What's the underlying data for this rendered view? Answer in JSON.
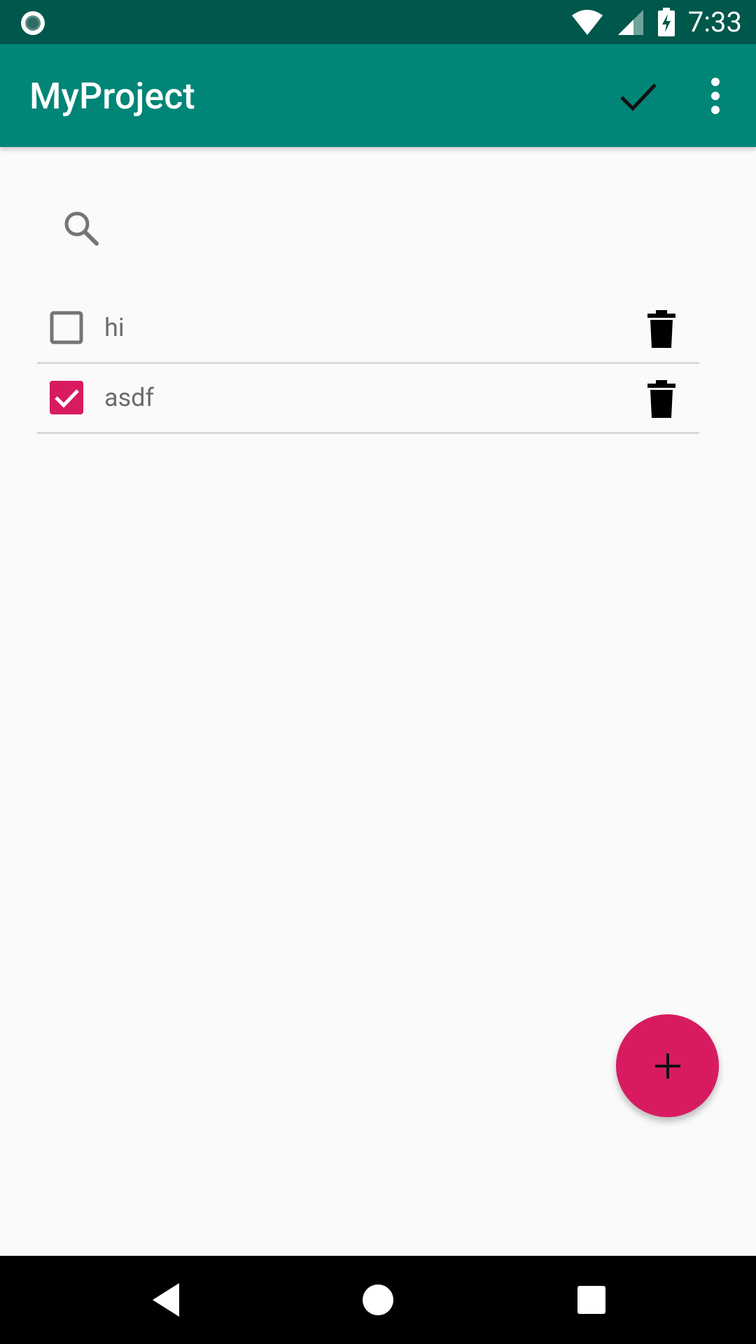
{
  "status_bar": {
    "time": "7:33",
    "icons": [
      "notification-dot-icon",
      "wifi-icon",
      "signal-icon",
      "battery-charging-icon"
    ]
  },
  "app_bar": {
    "title": "MyProject",
    "actions": [
      "check-icon",
      "more-vert-icon"
    ],
    "color": "#008577",
    "status_color": "#00574b"
  },
  "search": {
    "icon": "search-icon"
  },
  "todo_list": {
    "items": [
      {
        "label": "hi",
        "checked": false
      },
      {
        "label": "asdf",
        "checked": true
      }
    ],
    "accent": "#d81b60"
  },
  "fab": {
    "icon": "plus-icon",
    "color": "#d81b60"
  },
  "nav_bar": {
    "buttons": [
      "back-icon",
      "home-icon",
      "recents-icon"
    ]
  }
}
